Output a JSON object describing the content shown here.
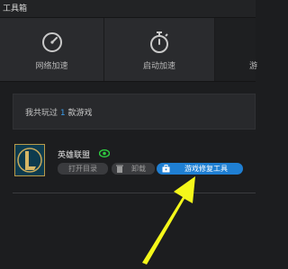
{
  "window": {
    "title": "工具箱"
  },
  "tabs": [
    {
      "label": "网络加速",
      "icon": "speedometer-icon"
    },
    {
      "label": "启动加速",
      "icon": "stopwatch-icon"
    },
    {
      "label": "游",
      "icon": ""
    }
  ],
  "summary": {
    "prefix": "我共玩过",
    "count": "1",
    "suffix": "款游戏"
  },
  "game": {
    "name": "英雄联盟",
    "icon": "league-of-legends-logo-icon",
    "open_dir_label": "打开目录",
    "uninstall_label": "卸载",
    "repair_label": "游戏修复工具"
  },
  "annotation": {
    "arrow_color": "#f4f71a"
  },
  "colors": {
    "accent": "#1f7fd3",
    "count": "#3a9bea",
    "visible": "#2ecc40"
  }
}
